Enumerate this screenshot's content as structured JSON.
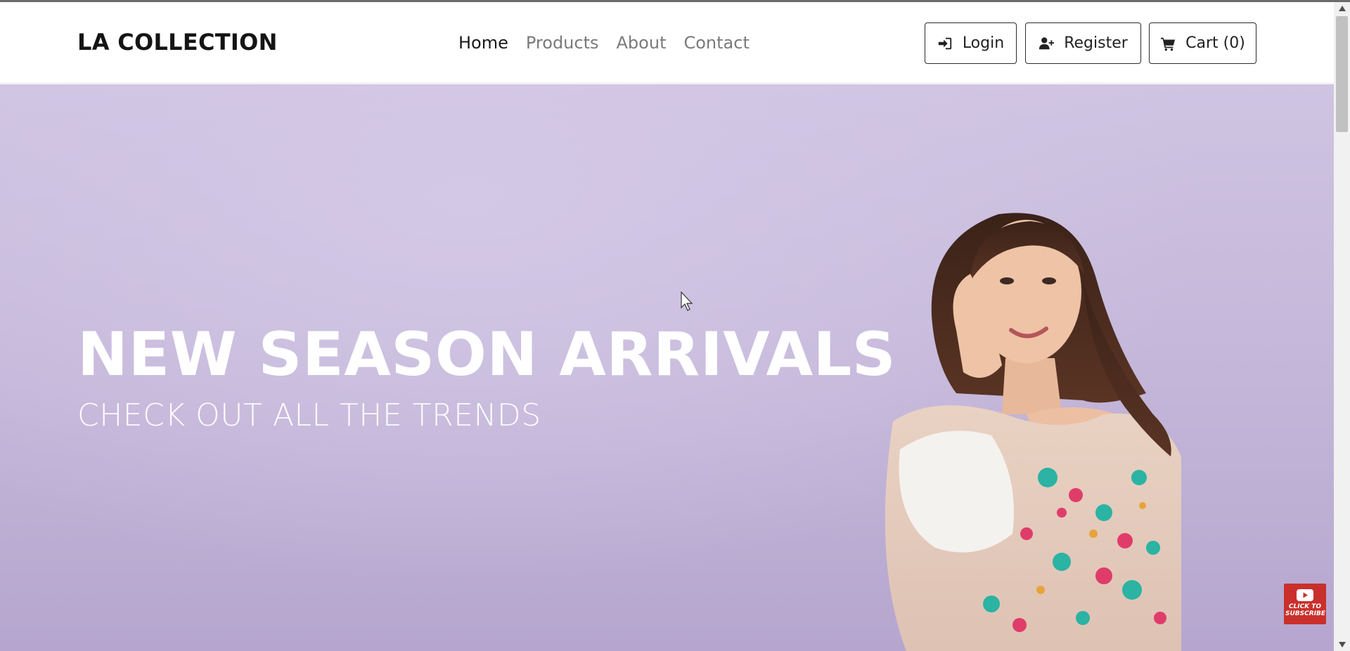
{
  "navbar": {
    "brand": "LA COLLECTION",
    "links": [
      "Home",
      "Products",
      "About",
      "Contact"
    ],
    "login_label": "Login",
    "register_label": "Register",
    "cart_label": "Cart (0)"
  },
  "hero": {
    "title": "NEW SEASON ARRIVALS",
    "subtitle": "CHECK OUT ALL THE TRENDS"
  },
  "overlay": {
    "subscribe_text": "CLICK TO SUBSCRIBE"
  },
  "icons": {
    "login": "sign-in-icon",
    "register": "user-plus-icon",
    "cart": "shopping-cart-icon",
    "subscribe": "youtube-play-icon"
  },
  "colors": {
    "hero_background": "#c9bde0",
    "subscribe_badge": "#c9302c",
    "nav_active": "#1a1a1a",
    "nav_inactive": "#7a7a7a"
  }
}
